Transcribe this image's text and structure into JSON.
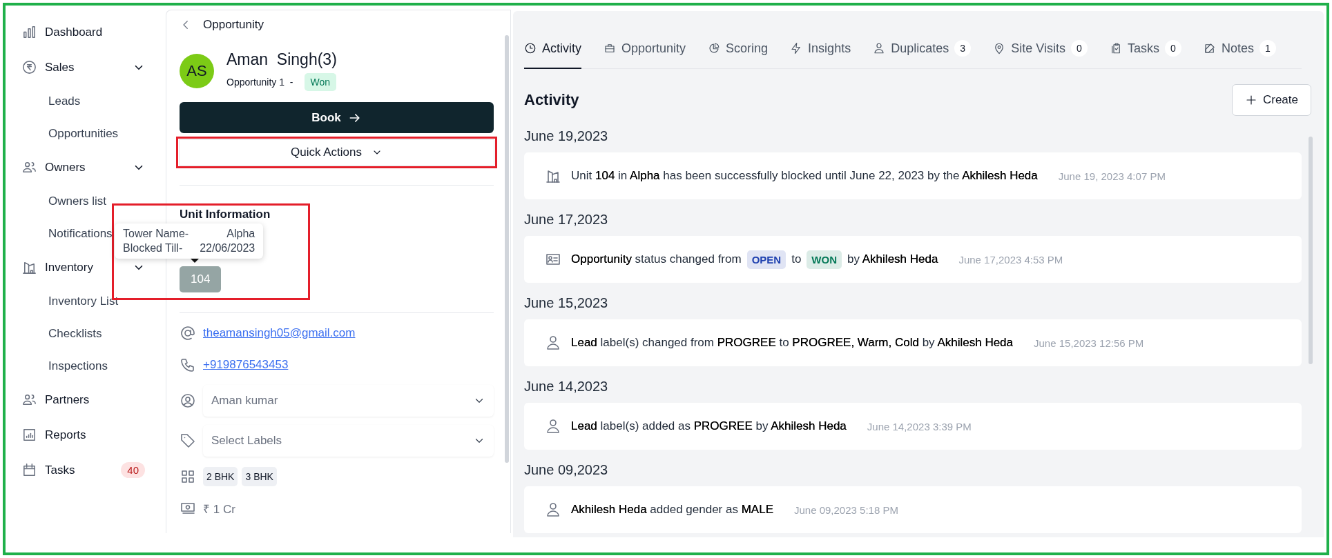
{
  "sidebar": {
    "items": [
      {
        "label": "Dashboard"
      },
      {
        "label": "Sales",
        "expanded": true,
        "children": [
          {
            "label": "Leads"
          },
          {
            "label": "Opportunities"
          }
        ]
      },
      {
        "label": "Owners",
        "expanded": true,
        "children": [
          {
            "label": "Owners list"
          },
          {
            "label": "Notifications"
          }
        ]
      },
      {
        "label": "Inventory",
        "expanded": true,
        "children": [
          {
            "label": "Inventory List"
          },
          {
            "label": "Checklists"
          },
          {
            "label": "Inspections"
          }
        ]
      },
      {
        "label": "Partners"
      },
      {
        "label": "Reports"
      },
      {
        "label": "Tasks",
        "badge": "40"
      }
    ]
  },
  "detail": {
    "title": "Opportunity",
    "initials": "AS",
    "name": "Aman  Singh(3)",
    "subtitle": "Opportunity 1  -",
    "status": "Won",
    "book_button": "Book",
    "quick_actions": "Quick Actions",
    "unit_heading": "Unit Information",
    "units": [
      {
        "label": "104"
      }
    ],
    "tooltip": [
      {
        "label": "Tower Name-",
        "value": "Alpha"
      },
      {
        "label": "Blocked Till-",
        "value": "22/06/2023"
      }
    ],
    "email": "theamansingh05@gmail.com",
    "phone": "+919876543453",
    "owner": {
      "value": "Aman kumar"
    },
    "labels": {
      "placeholder": "Select Labels"
    },
    "configurations": [
      "2 BHK",
      "3 BHK"
    ],
    "budget": "₹ 1 Cr"
  },
  "activity": {
    "tabs": [
      {
        "label": "Activity",
        "selected": true
      },
      {
        "label": "Opportunity",
        "selected": false
      },
      {
        "label": "Scoring",
        "selected": false
      },
      {
        "label": "Insights",
        "selected": false
      },
      {
        "label": "Duplicates",
        "selected": false,
        "count": "3"
      },
      {
        "label": "Site Visits",
        "selected": false,
        "count": "0"
      },
      {
        "label": "Tasks",
        "selected": false,
        "count": "0"
      },
      {
        "label": "Notes",
        "selected": false,
        "count": "1"
      }
    ],
    "title": "Activity",
    "create_button": "Create",
    "groups": [
      {
        "date": "June 19,2023",
        "entries": [
          {
            "kind": "unit",
            "segments": [
              {
                "kind": "text",
                "text": "Unit **104** in **Alpha** has been successfully blocked until June 22, 2023 by the **Akhilesh Heda**"
              }
            ],
            "time": "June 19, 2023 4:07 PM"
          }
        ]
      },
      {
        "date": "June 17,2023",
        "entries": [
          {
            "kind": "card",
            "segments": [
              {
                "kind": "text",
                "text": "**Opportunity** status changed from"
              },
              {
                "kind": "tag",
                "text": "OPEN",
                "color": "#1e40af"
              },
              {
                "kind": "text",
                "text": "to"
              },
              {
                "kind": "tag",
                "text": "WON",
                "color": "#047857"
              },
              {
                "kind": "text",
                "text": "by **Akhilesh Heda**"
              }
            ],
            "time": "June 17,2023 4:53 PM"
          }
        ]
      },
      {
        "date": "June 15,2023",
        "entries": [
          {
            "kind": "person",
            "segments": [
              {
                "kind": "text",
                "text": "**Lead** label(s) changed from **PROGREE** to **PROGREE, Warm, Cold** by **Akhilesh Heda**"
              }
            ],
            "time": "June 15,2023 12:56 PM"
          }
        ]
      },
      {
        "date": "June 14,2023",
        "entries": [
          {
            "kind": "person",
            "segments": [
              {
                "kind": "text",
                "text": "**Lead** label(s) added as **PROGREE** by **Akhilesh Heda**"
              }
            ],
            "time": "June 14,2023 3:39 PM"
          }
        ]
      },
      {
        "date": "June 09,2023",
        "entries": [
          {
            "kind": "person",
            "segments": [
              {
                "kind": "text",
                "text": "**Akhilesh Heda** added gender as **MALE**"
              }
            ],
            "time": "June 09,2023 5:18 PM"
          }
        ]
      }
    ]
  }
}
